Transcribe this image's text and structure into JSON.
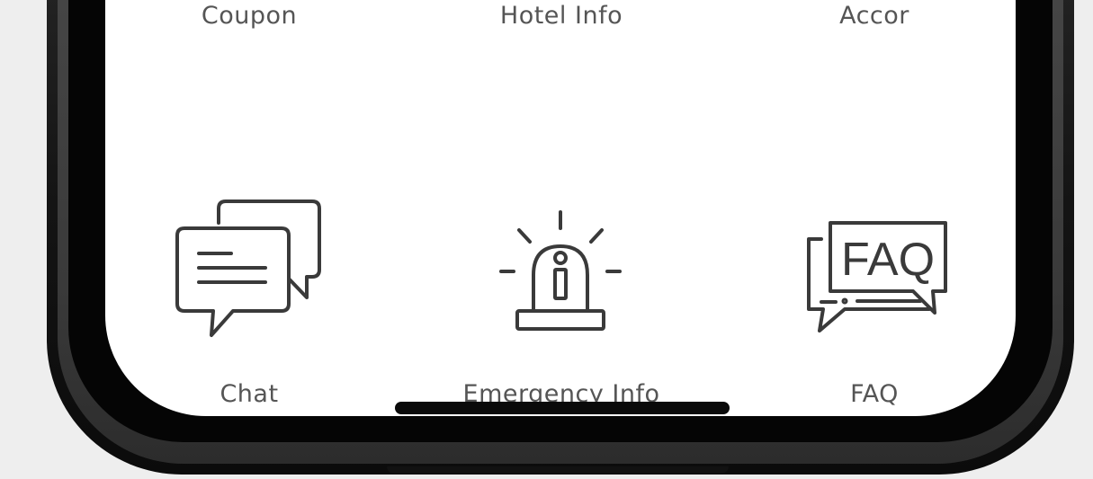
{
  "grid": {
    "row1": [
      {
        "label": "Coupon"
      },
      {
        "label": "Hotel Info"
      },
      {
        "label": "Accor"
      }
    ],
    "row2": [
      {
        "label": "Chat",
        "icon": "chat-bubbles-icon"
      },
      {
        "label": "Emergency Info",
        "icon": "siren-info-icon"
      },
      {
        "label": "FAQ",
        "icon": "faq-bubbles-icon"
      }
    ]
  },
  "icons": {
    "faq_text": "FAQ"
  },
  "colors": {
    "screen_bg": "#ffffff",
    "label_text": "#555555",
    "icon_stroke": "#3a3a3a",
    "phone_frame": "#141414",
    "page_bg": "#eeeeee"
  }
}
